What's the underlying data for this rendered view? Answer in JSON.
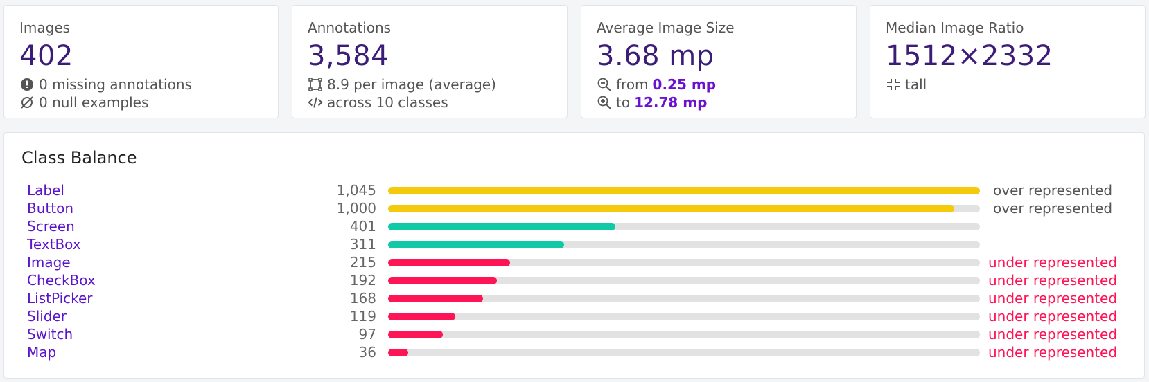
{
  "stats": {
    "images": {
      "label": "Images",
      "value": "402",
      "line1": "0 missing annotations",
      "line2": "0 null examples"
    },
    "annotations": {
      "label": "Annotations",
      "value": "3,584",
      "line1": "8.9 per image (average)",
      "line2": "across 10 classes"
    },
    "avg_size": {
      "label": "Average Image Size",
      "value": "3.68 mp",
      "line1_prefix": "from",
      "line1_value": "0.25 mp",
      "line2_prefix": "to",
      "line2_value": "12.78 mp"
    },
    "median_ratio": {
      "label": "Median Image Ratio",
      "value": "1512×2332",
      "line1": "tall"
    }
  },
  "balance": {
    "title": "Class Balance",
    "max_value": 1045,
    "colors": {
      "over": "#f5ca0c",
      "normal": "#10c9a7",
      "under": "#ff1456",
      "over_text": "#555555",
      "under_text": "#ff1456"
    },
    "rows": [
      {
        "name": "Label",
        "count": "1,045",
        "value": 1045,
        "kind": "over",
        "status": "over represented"
      },
      {
        "name": "Button",
        "count": "1,000",
        "value": 1000,
        "kind": "over",
        "status": "over represented"
      },
      {
        "name": "Screen",
        "count": "401",
        "value": 401,
        "kind": "normal",
        "status": ""
      },
      {
        "name": "TextBox",
        "count": "311",
        "value": 311,
        "kind": "normal",
        "status": ""
      },
      {
        "name": "Image",
        "count": "215",
        "value": 215,
        "kind": "under",
        "status": "under represented"
      },
      {
        "name": "CheckBox",
        "count": "192",
        "value": 192,
        "kind": "under",
        "status": "under represented"
      },
      {
        "name": "ListPicker",
        "count": "168",
        "value": 168,
        "kind": "under",
        "status": "under represented"
      },
      {
        "name": "Slider",
        "count": "119",
        "value": 119,
        "kind": "under",
        "status": "under represented"
      },
      {
        "name": "Switch",
        "count": "97",
        "value": 97,
        "kind": "under",
        "status": "under represented"
      },
      {
        "name": "Map",
        "count": "36",
        "value": 36,
        "kind": "under",
        "status": "under represented"
      }
    ]
  }
}
